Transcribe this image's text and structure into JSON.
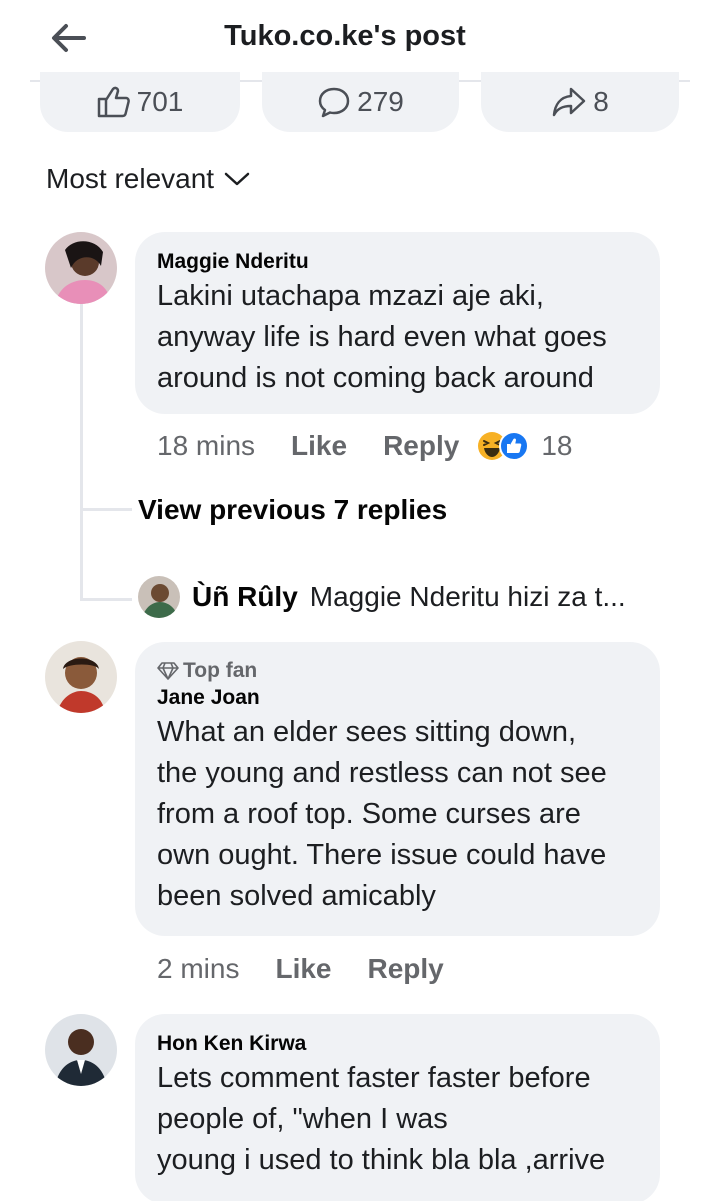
{
  "header": {
    "title": "Tuko.co.ke's post",
    "back_icon": "arrow-left-icon"
  },
  "stats": {
    "likes": "701",
    "comments": "279",
    "shares": "8"
  },
  "sort": {
    "label": "Most relevant"
  },
  "comments": [
    {
      "author": "Maggie Nderitu",
      "text_lines": [
        "Lakini utachapa mzazi aje aki,",
        "anyway life is hard even what goes",
        "around is not coming back around"
      ],
      "time": "18 mins",
      "like": "Like",
      "reply": "Reply",
      "reaction_count": "18",
      "view_previous": "View previous 7 replies",
      "latest_reply": {
        "author": "Ùñ Rûly",
        "text": "Maggie Nderitu hizi za t..."
      }
    },
    {
      "badge": "Top fan",
      "author": "Jane Joan",
      "text_lines": [
        "What an elder sees sitting down,",
        "the young and restless can not see",
        "from a roof top. Some curses are",
        "own ought. There issue could have",
        "been solved amicably"
      ],
      "time": "2 mins",
      "like": "Like",
      "reply": "Reply"
    },
    {
      "author": "Hon Ken Kirwa",
      "text_lines": [
        "Lets comment faster faster before",
        "people of, \"when I was",
        "young i used to think bla bla ,arrive"
      ]
    }
  ],
  "colors": {
    "bubble": "#f0f2f5",
    "muted": "#65676b",
    "like_blue": "#1877f2",
    "haha_yellow": "#f7b125"
  }
}
